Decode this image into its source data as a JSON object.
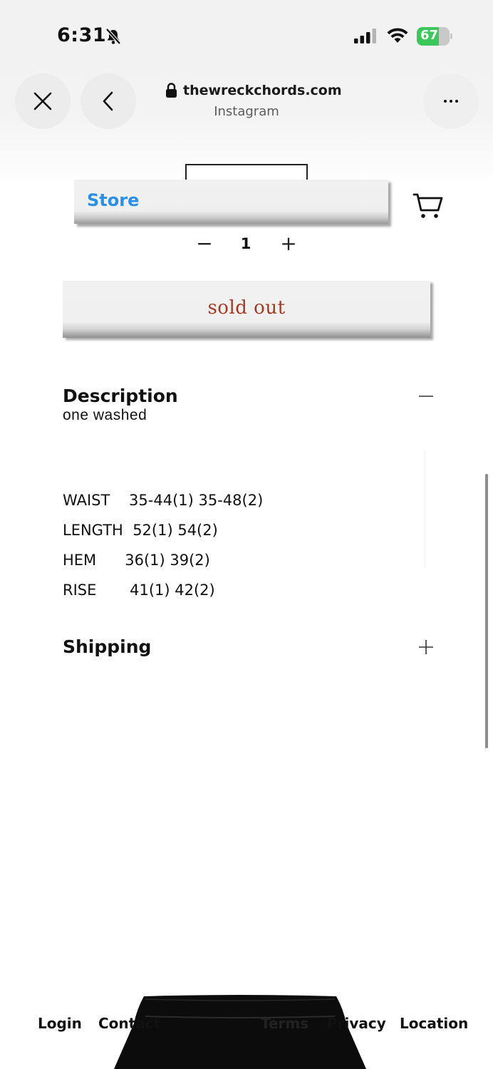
{
  "status_bar": {
    "time": "6:31",
    "battery_level": "67",
    "battery_fraction": 0.67,
    "icons": [
      "bell-slash-icon",
      "cellular-signal-icon",
      "wifi-icon",
      "battery-icon"
    ]
  },
  "browser": {
    "domain": "thewreckchords.com",
    "source": "Instagram",
    "icons": [
      "close-icon",
      "back-chevron-icon",
      "lock-icon",
      "more-icon"
    ]
  },
  "store_bar": {
    "label": "Store",
    "label_color": "#2a8fe6",
    "cart_icon": "cart-icon"
  },
  "quantity": {
    "minus": "−",
    "value": "1",
    "plus": "+"
  },
  "buy_button": {
    "label": "sold out",
    "color": "#a33a22"
  },
  "description": {
    "title": "Description",
    "subtitle": "one washed",
    "toggle_icon": "minus-icon",
    "specs": [
      {
        "label": "WAIST",
        "value": "35-44(1) 35-48(2)"
      },
      {
        "label": "LENGTH",
        "value": "52(1) 54(2)"
      },
      {
        "label": "HEM",
        "value": "36(1) 39(2)"
      },
      {
        "label": "RISE",
        "value": "41(1) 42(2)"
      }
    ]
  },
  "shipping": {
    "title": "Shipping",
    "toggle_icon": "plus-icon"
  },
  "footer": {
    "links": [
      "Login",
      "Contact",
      "Terms",
      "Privacy",
      "Location"
    ]
  }
}
